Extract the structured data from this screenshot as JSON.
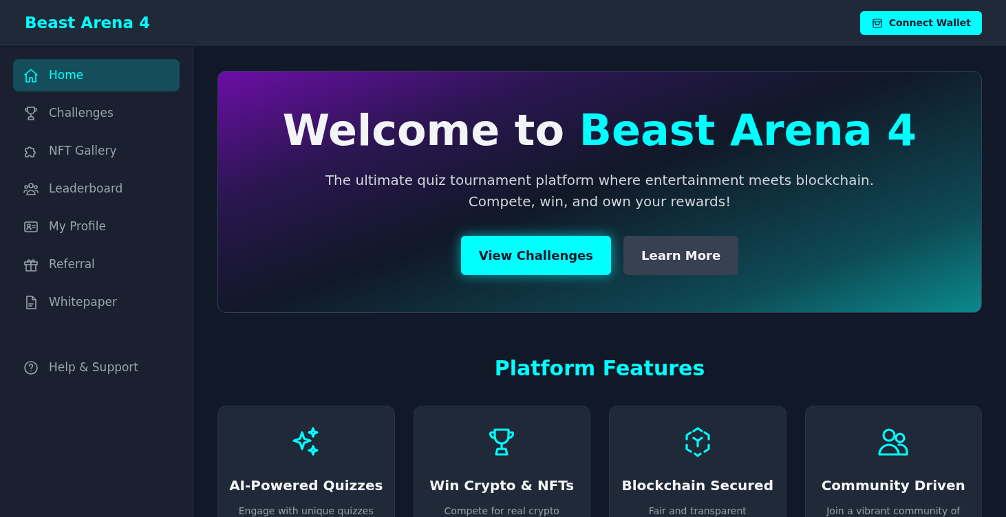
{
  "header": {
    "brand": "Beast Arena 4",
    "wallet_button": "Connect Wallet"
  },
  "sidebar": {
    "items": [
      {
        "label": "Home",
        "selected": true
      },
      {
        "label": "Challenges",
        "selected": false
      },
      {
        "label": "NFT Gallery",
        "selected": false
      },
      {
        "label": "Leaderboard",
        "selected": false
      },
      {
        "label": "My Profile",
        "selected": false
      },
      {
        "label": "Referral",
        "selected": false
      },
      {
        "label": "Whitepaper",
        "selected": false
      }
    ],
    "footer_items": [
      {
        "label": "Help & Support",
        "selected": false
      }
    ]
  },
  "hero": {
    "title_lead": "Welcome to",
    "title_highlight": "Beast Arena 4",
    "subtitle_lines": [
      "The ultimate quiz tournament platform where entertainment meets blockchain.",
      "Compete, win, and own your rewards!"
    ],
    "buttons": [
      {
        "label": "View Challenges",
        "kind": "primary"
      },
      {
        "label": "Learn More",
        "kind": "secondary"
      }
    ]
  },
  "features": {
    "title": "Platform Features",
    "cards": [
      {
        "title": "AI-Powered Quizzes",
        "description": "Engage with unique quizzes"
      },
      {
        "title": "Win Crypto & NFTs",
        "description": "Compete for real crypto"
      },
      {
        "title": "Blockchain Secured",
        "description": "Fair and transparent"
      },
      {
        "title": "Community Driven",
        "description": "Join a vibrant community of"
      }
    ]
  }
}
